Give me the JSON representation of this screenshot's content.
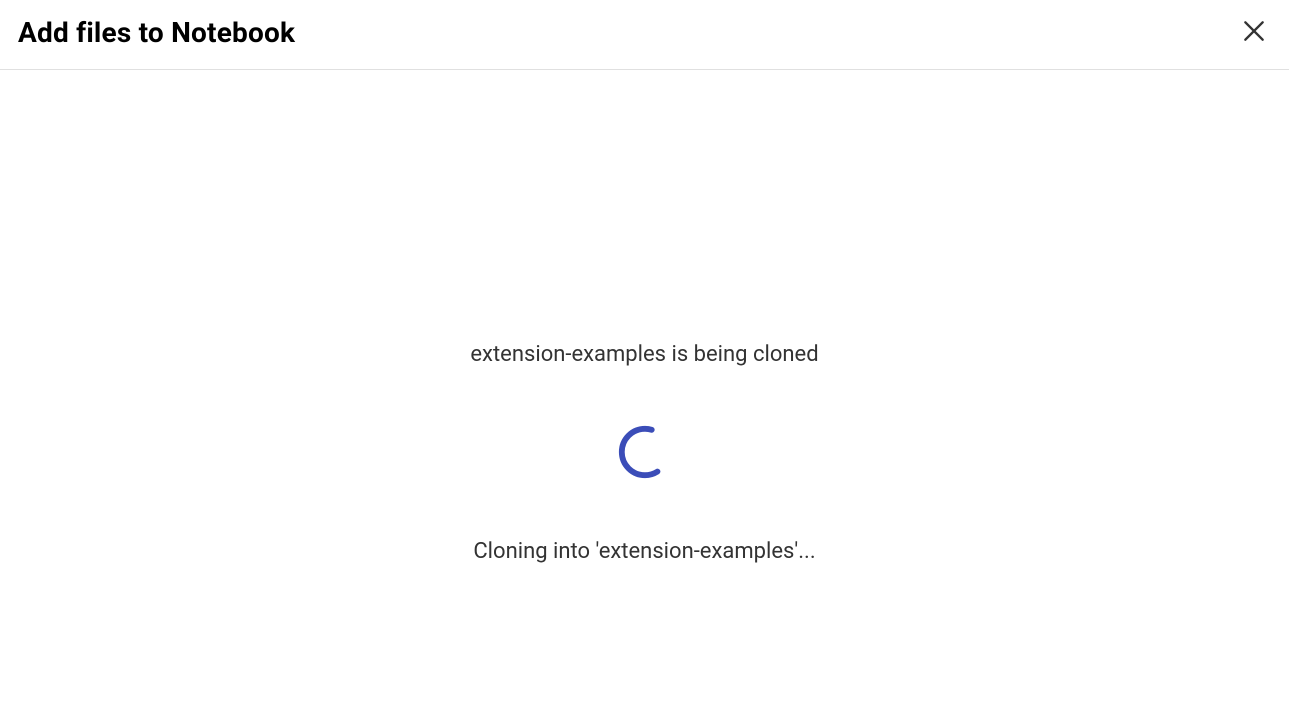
{
  "dialog": {
    "title": "Add files to Notebook",
    "status_heading": "extension-examples is being cloned",
    "progress_text": "Cloning into 'extension-examples'..."
  }
}
